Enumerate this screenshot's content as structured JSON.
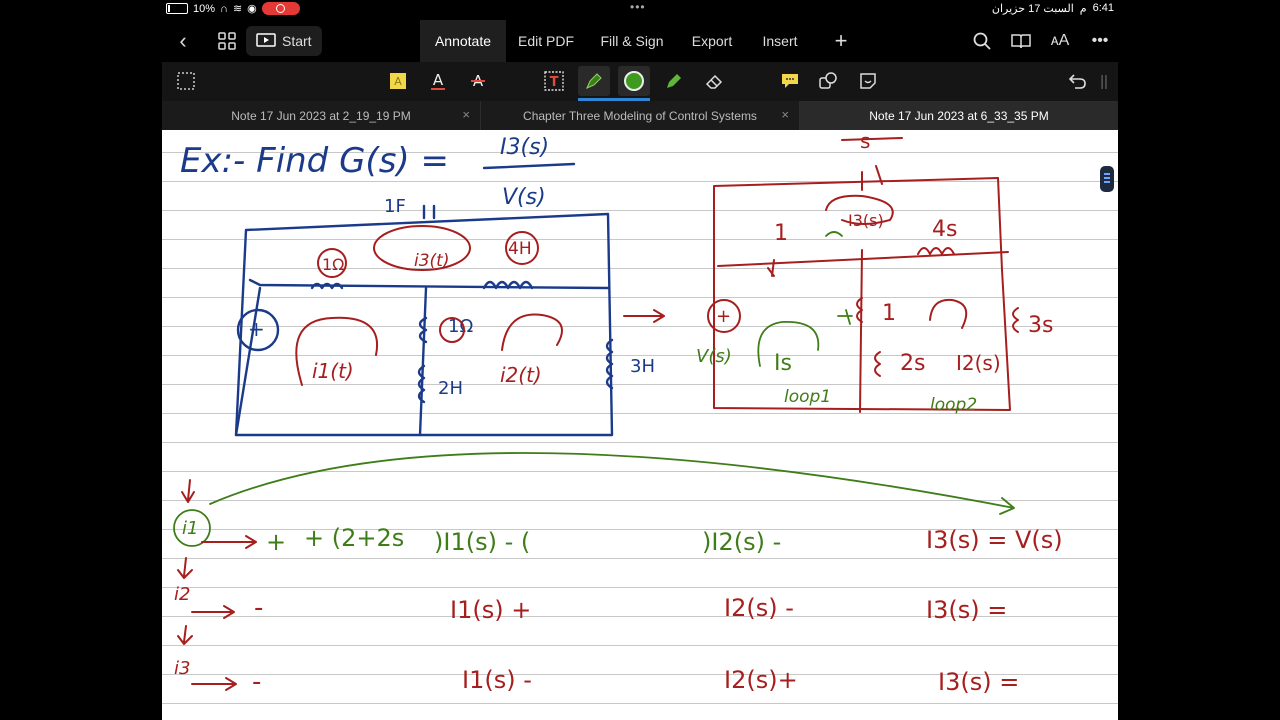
{
  "status": {
    "battery": "10%",
    "time": "6:41",
    "date": "السبت 17 حزيران",
    "period": "م"
  },
  "toolbar": {
    "back_icon": "chevron-left-icon",
    "grid_icon": "grid-icon",
    "start_label": "Start",
    "menus": [
      "Annotate",
      "Edit PDF",
      "Fill & Sign",
      "Export",
      "Insert"
    ],
    "active_menu": "Annotate"
  },
  "tabs": [
    {
      "label": "Note 17 Jun 2023 at 2_19_19 PM"
    },
    {
      "label": "Chapter Three Modeling of Control Systems"
    },
    {
      "label": "Note 17 Jun 2023 at 6_33_35 PM"
    }
  ],
  "colors": {
    "ink_blue": "#1b3b8a",
    "ink_red": "#a61e1e",
    "ink_green": "#3e7d18",
    "accent": "#2f86d6",
    "record": "#e53935"
  },
  "notes": {
    "title": "Ex:- Find G(s) =",
    "num": "I3(s)",
    "den": "V(s)",
    "left_circuit": {
      "cap": "1F",
      "r1": "1Ω",
      "loop3": "i3(t)",
      "l1": "4H",
      "r2": "1Ω",
      "l2": "2H",
      "l3": "3H",
      "loop1": "i1(t)",
      "loop2": "i2(t)"
    },
    "right_circuit": {
      "top": "s",
      "r1": "1",
      "loop3": "I3(s)",
      "l1": "4s",
      "r2": "1",
      "l2": "2s",
      "l3": "3s",
      "source": "V(s)",
      "loop1": "Is",
      "loop2": "I2(s)",
      "loop1_label": "loop1",
      "loop2_label": "loop2"
    },
    "eq1": {
      "tag": "i1",
      "coef": "+ (2+2s",
      "i1": ")I1(s) - (",
      "i2": ")I2(s) -",
      "i3": "I3(s) = V(s)"
    },
    "eq2": {
      "tag": "i2",
      "coef": "-",
      "i1": "I1(s) +",
      "i2": "I2(s) -",
      "i3": "I3(s) ="
    },
    "eq3": {
      "tag": "i3",
      "coef": "-",
      "i1": "I1(s) -",
      "i2": "I2(s)+",
      "i3": "I3(s) ="
    }
  }
}
